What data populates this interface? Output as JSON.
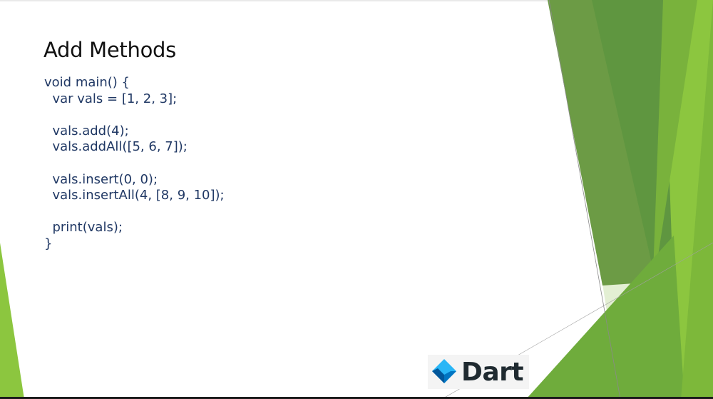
{
  "slide": {
    "title": "Add Methods",
    "code_lines": [
      "void main() {",
      "  var vals = [1, 2, 3];",
      "",
      "  vals.add(4);",
      "  vals.addAll([5, 6, 7]);",
      "",
      "  vals.insert(0, 0);",
      "  vals.insertAll(4, [8, 9, 10]);",
      "",
      "  print(vals);",
      "}"
    ],
    "logo_text": "Dart",
    "logo_icon": "dart-logo-icon"
  },
  "colors": {
    "title": "#111111",
    "code": "#203864",
    "green_dark": "#5f8c3a",
    "green_mid": "#8cc63f",
    "green_light": "#d9eac0",
    "dart_teal": "#01579b",
    "dart_blue": "#29b6f6"
  }
}
